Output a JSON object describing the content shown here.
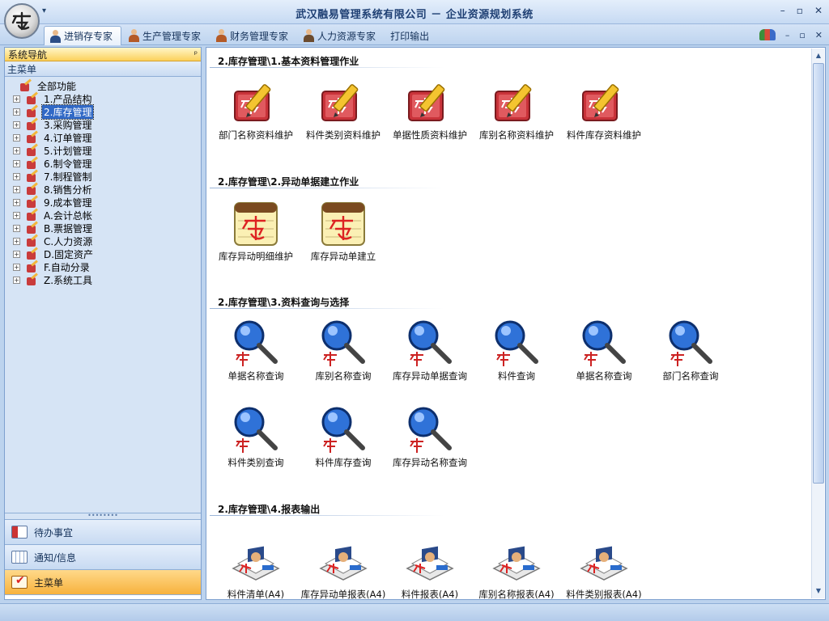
{
  "window": {
    "title": "武汉融易管理系统有限公司 － 企业资源规划系统",
    "controls": [
      "–",
      "▫",
      "✕"
    ]
  },
  "quick_access": "▾",
  "tabs": [
    {
      "label": "进销存专家",
      "active": true
    },
    {
      "label": "生产管理专家"
    },
    {
      "label": "财务管理专家"
    },
    {
      "label": "人力资源专家"
    },
    {
      "label": "打印输出"
    }
  ],
  "tab_right_controls": [
    "–",
    "▫",
    "✕"
  ],
  "nav": {
    "header": "系统导航",
    "pin": "ᵖ",
    "main_menu": "主菜单",
    "root": "全部功能",
    "items": [
      "1.产品结构",
      "2.库存管理",
      "3.采购管理",
      "4.订单管理",
      "5.计划管理",
      "6.制令管理",
      "7.制程管制",
      "8.销售分析",
      "9.成本管理",
      "A.会计总帐",
      "B.票据管理",
      "C.人力资源",
      "D.固定资产",
      "F.自动分录",
      "Z.系统工具"
    ],
    "selected_index": 1,
    "expander": "+",
    "splitter": "••••••••",
    "buttons": [
      {
        "label": "待办事宜"
      },
      {
        "label": "通知/信息"
      },
      {
        "label": "主菜单",
        "active": true
      }
    ]
  },
  "sections": [
    {
      "title": "2.库存管理\\1.基本资料管理作业",
      "icon": "folder-pencil-icon",
      "items": [
        "部门名称资料维护",
        "料件类别资料维护",
        "单据性质资料维护",
        "库别名称资料维护",
        "料件库存资料维护"
      ]
    },
    {
      "title": "2.库存管理\\2.异动单据建立作业",
      "icon": "notepad-icon",
      "items": [
        "库存异动明细维护",
        "库存异动单建立"
      ]
    },
    {
      "title": "2.库存管理\\3.资料查询与选择",
      "icon": "magnifier-icon",
      "items": [
        "单据名称查询",
        "库别名称查询",
        "库存异动单据查询",
        "料件查询",
        "单据名称查询",
        "部门名称查询",
        "料件类别查询",
        "料件库存查询",
        "库存异动名称查询"
      ]
    },
    {
      "title": "2.库存管理\\4.报表输出",
      "icon": "report-icon",
      "items": [
        "料件清单(A4)",
        "库存异动单报表(A4)",
        "料件报表(A4)",
        "库别名称报表(A4)",
        "料件类别报表(A4)"
      ]
    }
  ],
  "scrollbar": {
    "up": "▲",
    "down": "▼"
  },
  "colors": {
    "accent": "#3169c6",
    "panel_header": "#fbd15b",
    "frame": "#7ea0cf"
  }
}
